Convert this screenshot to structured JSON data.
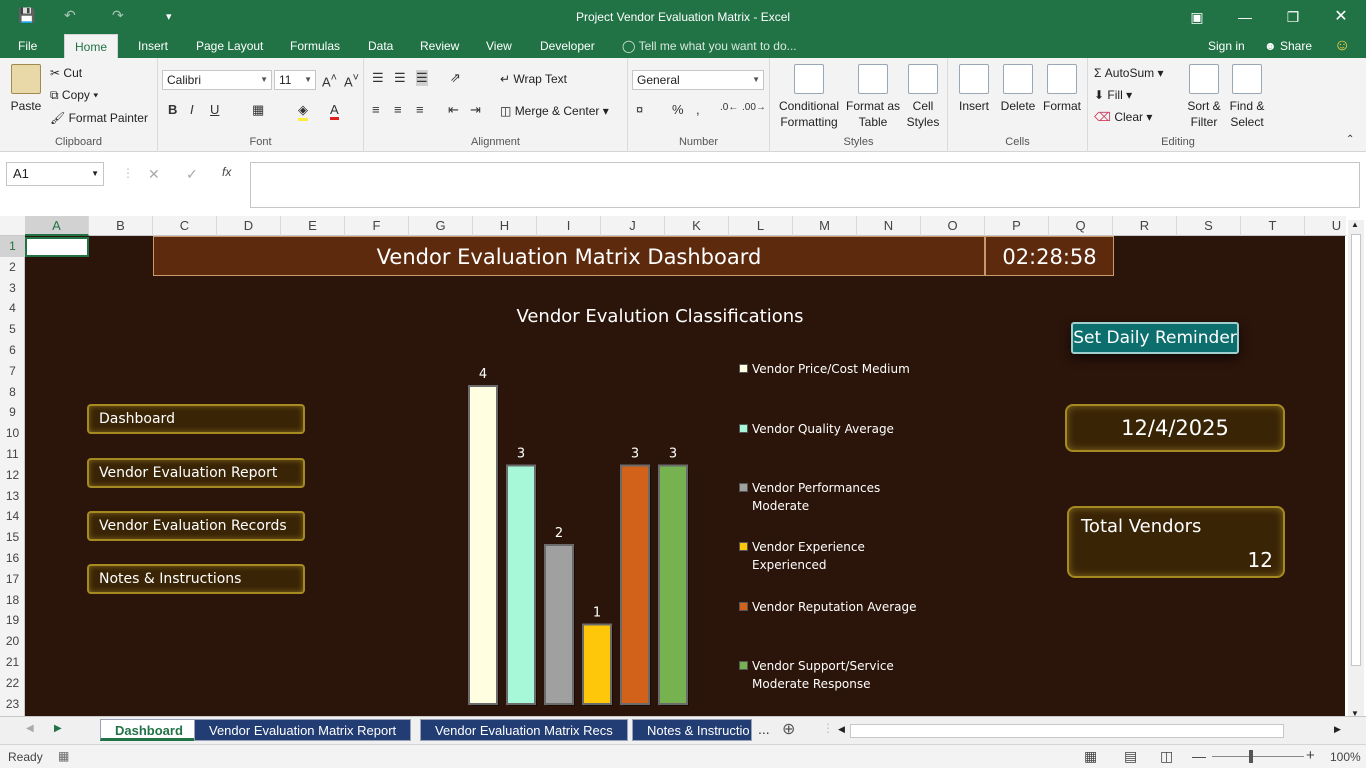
{
  "window": {
    "title": "Project Vendor Evaluation Matrix - Excel"
  },
  "ribbon_tabs": [
    "File",
    "Home",
    "Insert",
    "Page Layout",
    "Formulas",
    "Data",
    "Review",
    "View",
    "Developer"
  ],
  "tell_me": "Tell me what you want to do...",
  "sign_in": "Sign in",
  "share": "Share",
  "clipboard": {
    "paste": "Paste",
    "cut": "Cut",
    "copy": "Copy",
    "format_painter": "Format Painter",
    "label": "Clipboard"
  },
  "font": {
    "name": "Calibri",
    "size": "11",
    "label": "Font"
  },
  "alignment": {
    "wrap_text": "Wrap Text",
    "merge_center": "Merge & Center",
    "label": "Alignment"
  },
  "number": {
    "format": "General",
    "label": "Number"
  },
  "styles": {
    "conditional": "Conditional",
    "formatting": "Formatting",
    "format_as": "Format as",
    "table": "Table",
    "cell": "Cell",
    "cell_styles": "Styles",
    "label": "Styles"
  },
  "cells": {
    "insert": "Insert",
    "delete": "Delete",
    "format": "Format",
    "label": "Cells"
  },
  "editing": {
    "autosum": "AutoSum",
    "fill": "Fill",
    "clear": "Clear",
    "sort": "Sort &",
    "filter": "Filter",
    "find": "Find &",
    "select": "Select",
    "label": "Editing"
  },
  "formula_bar": {
    "name_box": "A1",
    "fx": "fx",
    "value": ""
  },
  "columns": [
    "A",
    "B",
    "C",
    "D",
    "E",
    "F",
    "G",
    "H",
    "I",
    "J",
    "K",
    "L",
    "M",
    "N",
    "O",
    "P",
    "Q",
    "R",
    "S",
    "T",
    "U"
  ],
  "rows": [
    "1",
    "2",
    "3",
    "4",
    "5",
    "6",
    "7",
    "8",
    "9",
    "10",
    "11",
    "12",
    "13",
    "14",
    "15",
    "16",
    "17",
    "18",
    "19",
    "20",
    "21",
    "22",
    "23"
  ],
  "dashboard": {
    "title": "Vendor Evaluation Matrix Dashboard",
    "clock": "02:28:58",
    "chart_title": "Vendor Evalution Classifications",
    "reminder_button": "Set Daily Reminder",
    "date": "12/4/2025",
    "total_label": "Total Vendors",
    "total_value": "12",
    "nav": [
      "Dashboard",
      "Vendor Evaluation Report",
      "Vendor Evaluation Records",
      "Notes & Instructions"
    ]
  },
  "chart_data": {
    "type": "bar",
    "categories": [
      "Vendor Price/Cost Medium",
      "Vendor Quality Average",
      "Vendor Performances Moderate",
      "Vendor Experience Experienced",
      "Vendor Reputation Average",
      "Vendor Support/Service Moderate Response"
    ],
    "legend_lines": [
      [
        "Vendor Price/Cost Medium"
      ],
      [
        "Vendor Quality Average"
      ],
      [
        "Vendor Performances",
        "Moderate"
      ],
      [
        "Vendor Experience",
        "Experienced"
      ],
      [
        "Vendor Reputation Average"
      ],
      [
        "Vendor Support/Service",
        "Moderate Response"
      ]
    ],
    "values": [
      4,
      3,
      2,
      1,
      3,
      3
    ],
    "colors": [
      "#fffee0",
      "#a6f8d8",
      "#a0a0a0",
      "#ffc70a",
      "#d2611a",
      "#76b24f"
    ],
    "title": "Vendor Evalution Classifications",
    "ylim": [
      0,
      4
    ],
    "grid": false,
    "legend": "right"
  },
  "sheet_tabs": [
    "Dashboard",
    "Vendor Evaluation Matrix Report",
    "Vendor Evaluation Matrix Recs",
    "Notes & Instructio"
  ],
  "sheet_tabs_more": "...",
  "status": {
    "ready": "Ready",
    "zoom": "100%"
  }
}
